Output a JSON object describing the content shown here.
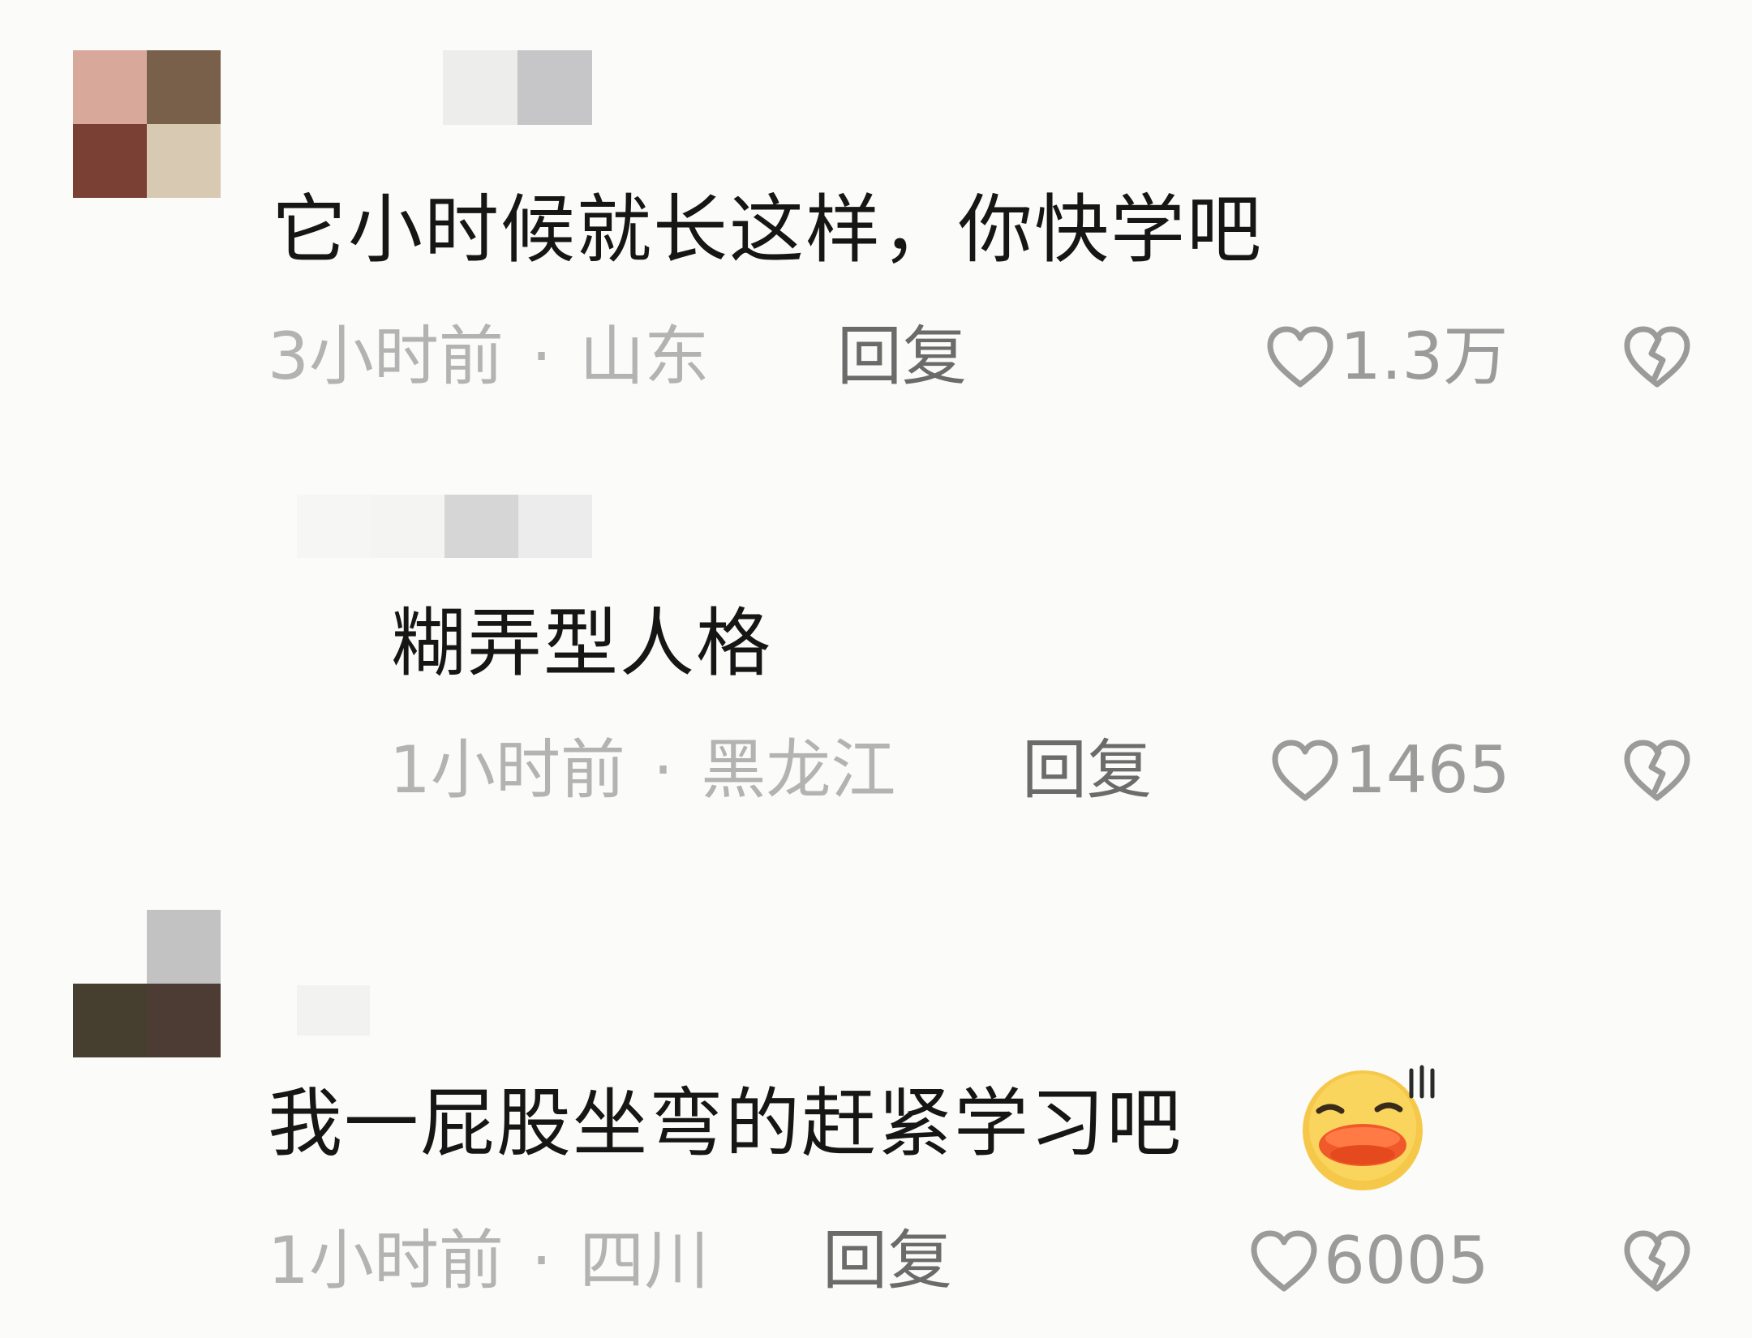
{
  "comments": [
    {
      "text": "它小时候就长这样，你快学吧",
      "time": "3小时前",
      "separator": "·",
      "location": "山东",
      "reply_label": "回复",
      "likes": "1.3万"
    },
    {
      "text": "糊弄型人格",
      "time": "1小时前",
      "separator": "·",
      "location": "黑龙江",
      "reply_label": "回复",
      "likes": "1465"
    },
    {
      "text": "我一屁股坐弯的赶紧学习吧",
      "time": "1小时前",
      "separator": "·",
      "location": "四川",
      "reply_label": "回复",
      "likes": "6005"
    }
  ],
  "icons": {
    "like": "heart-outline-icon",
    "dislike": "broken-heart-icon",
    "emoji": "duck-lips-sweat-emoji"
  },
  "colors": {
    "background": "#fbfbf9",
    "text_primary": "#161616",
    "text_meta": "#b3b3b3",
    "reply": "#6b6b6b",
    "icon": "#9b9b9b"
  }
}
